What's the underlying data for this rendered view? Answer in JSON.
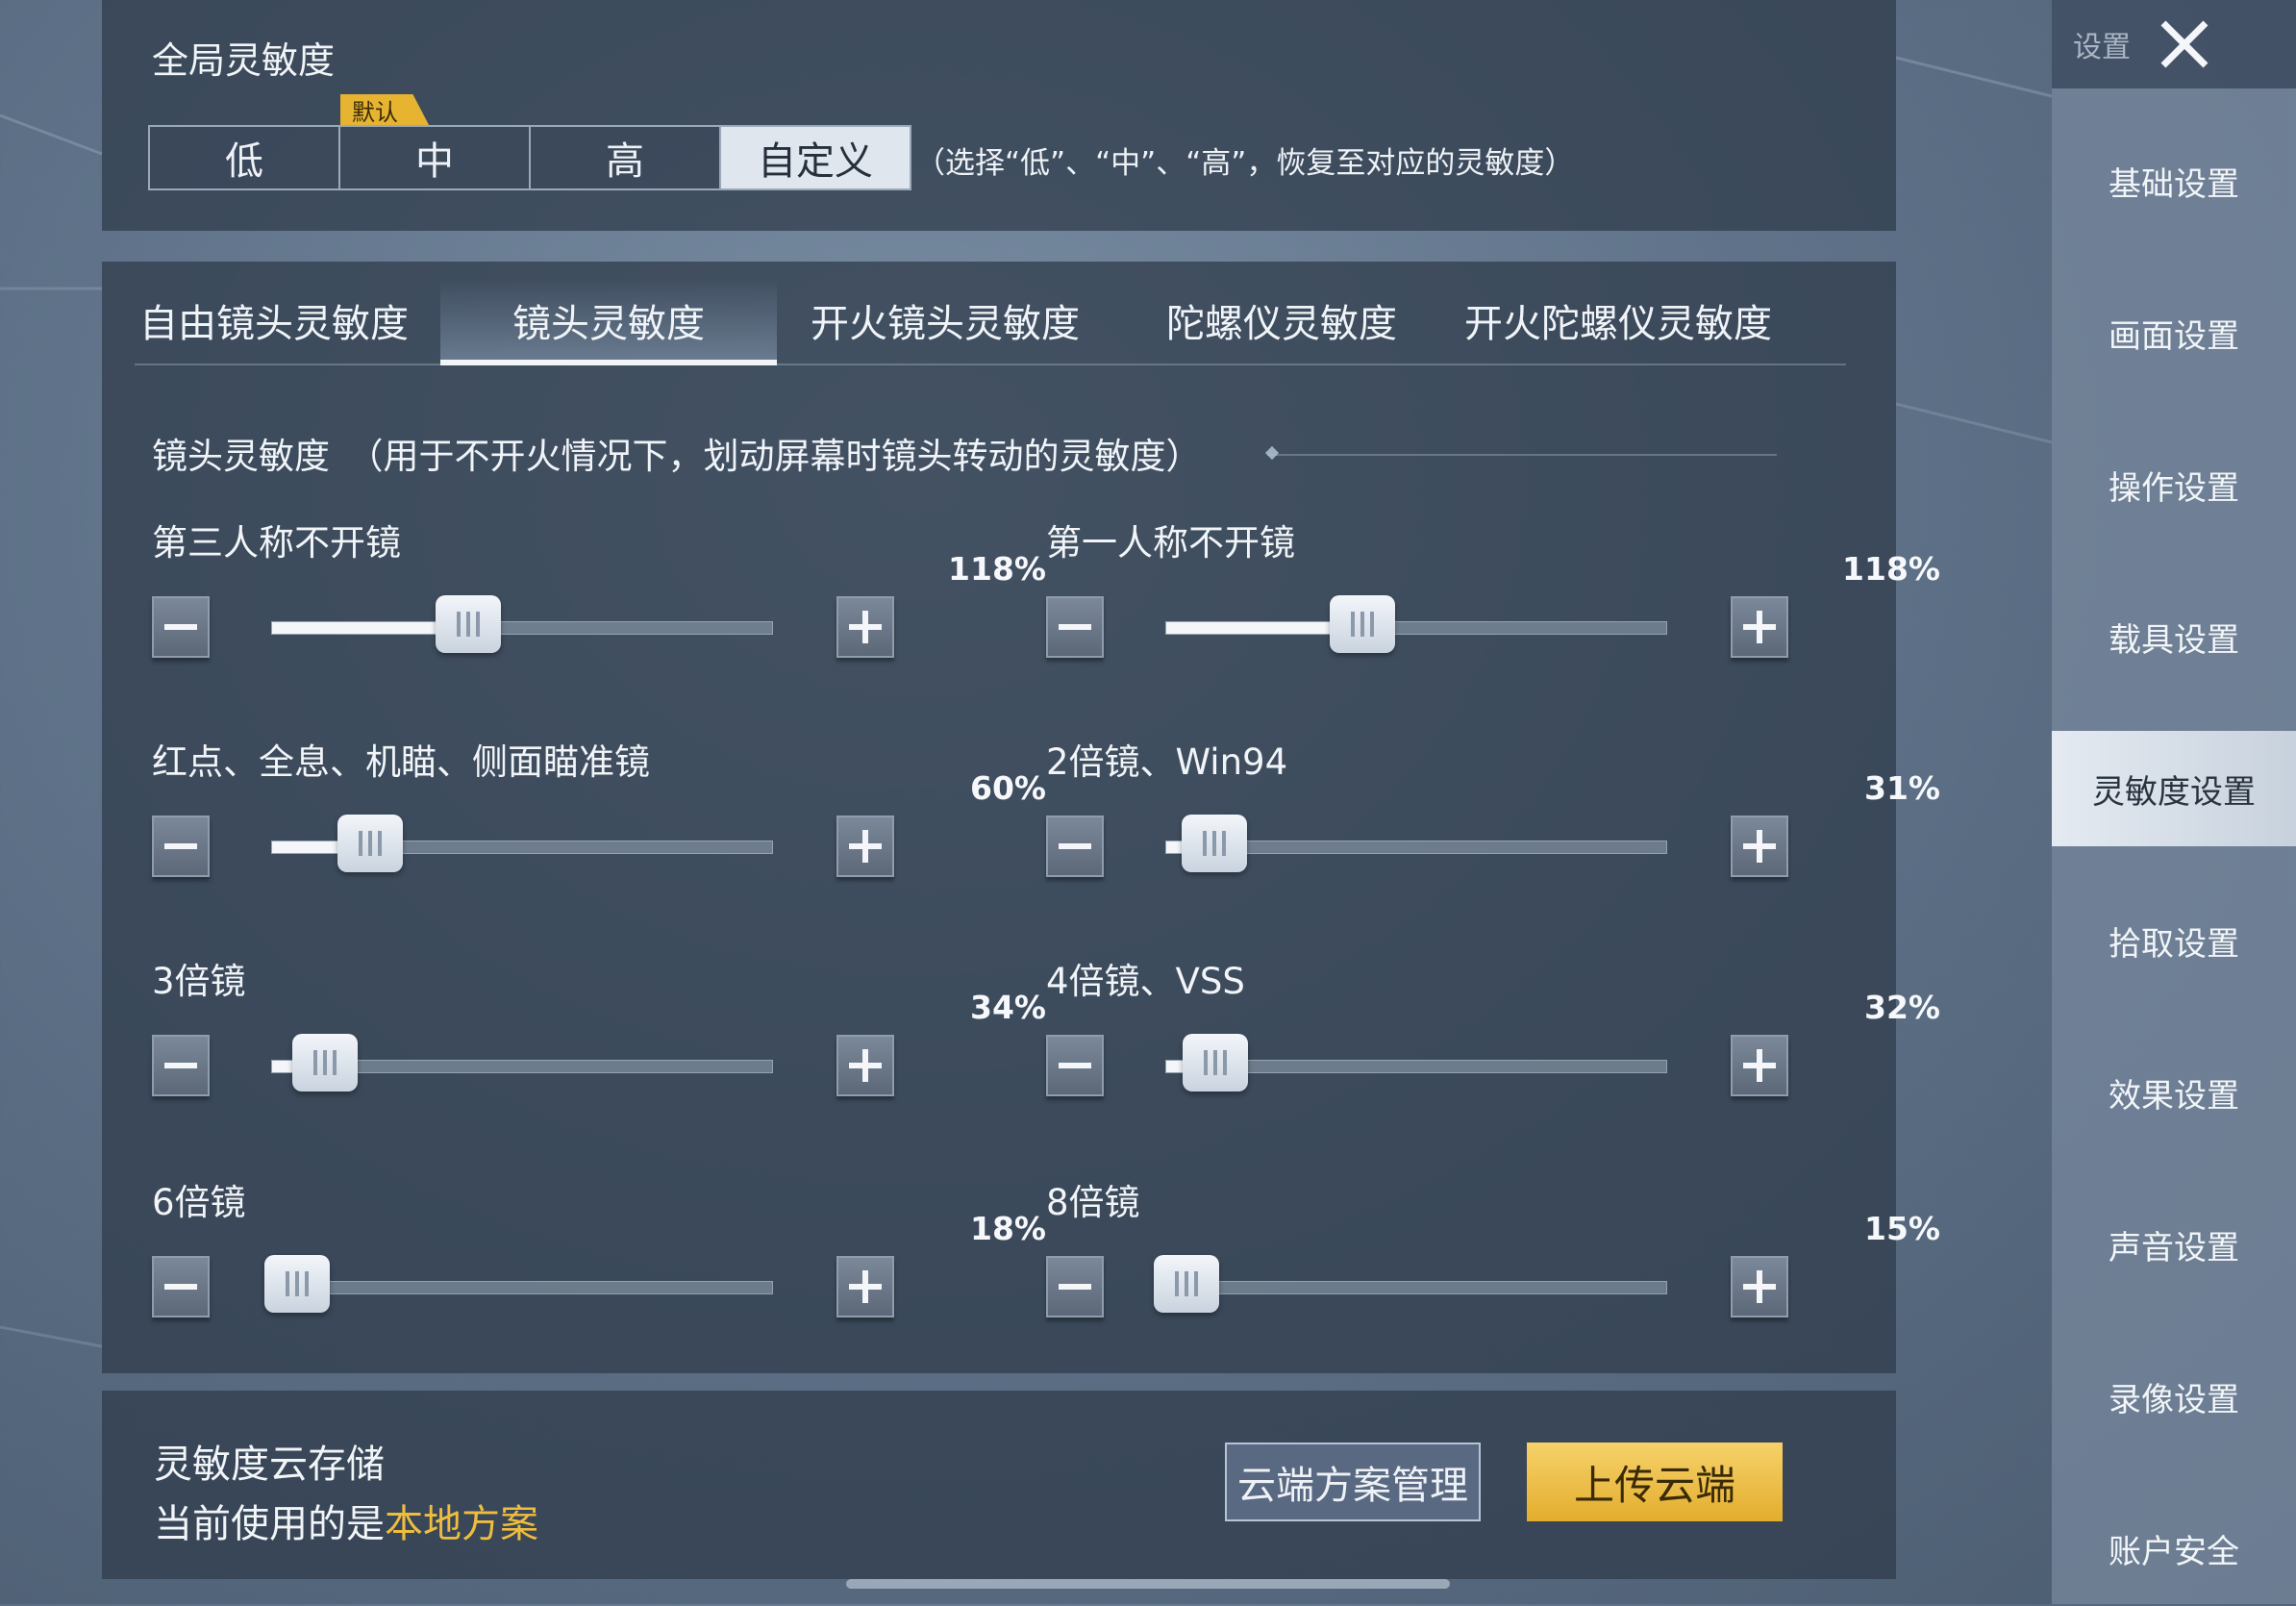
{
  "global": {
    "title": "全局灵敏度",
    "default_tag": "默认",
    "presets": [
      "低",
      "中",
      "高",
      "自定义"
    ],
    "active_preset": 3,
    "note": "（选择“低”、“中”、“高”，恢复至对应的灵敏度）"
  },
  "tabs": [
    {
      "label": "自由镜头灵敏度"
    },
    {
      "label": "镜头灵敏度"
    },
    {
      "label": "开火镜头灵敏度"
    },
    {
      "label": "陀螺仪灵敏度"
    },
    {
      "label": "开火陀螺仪灵敏度"
    }
  ],
  "active_tab": 1,
  "section": {
    "heading": "镜头灵敏度　（用于不开火情况下，划动屏幕时镜头转动的灵敏度）"
  },
  "sliders": [
    {
      "label": "第三人称不开镜",
      "value_text": "118%",
      "fraction": 0.39
    },
    {
      "label": "第一人称不开镜",
      "value_text": "118%",
      "fraction": 0.39
    },
    {
      "label": "红点、全息、机瞄、侧面瞄准镜",
      "value_text": "60%",
      "fraction": 0.195
    },
    {
      "label": "2倍镜、Win94",
      "value_text": "31%",
      "fraction": 0.095
    },
    {
      "label": "3倍镜",
      "value_text": "34%",
      "fraction": 0.105
    },
    {
      "label": "4倍镜、VSS",
      "value_text": "32%",
      "fraction": 0.098
    },
    {
      "label": "6倍镜",
      "value_text": "18%",
      "fraction": 0.05
    },
    {
      "label": "8倍镜",
      "value_text": "15%",
      "fraction": 0.04
    }
  ],
  "cloud": {
    "title": "灵敏度云存储",
    "current_prefix": "当前使用的是",
    "current_plan": "本地方案",
    "manage_label": "云端方案管理",
    "upload_label": "上传云端"
  },
  "sidebar": {
    "header": "设置",
    "items": [
      {
        "label": "基础设置"
      },
      {
        "label": "画面设置"
      },
      {
        "label": "操作设置"
      },
      {
        "label": "载具设置"
      },
      {
        "label": "灵敏度设置"
      },
      {
        "label": "拾取设置"
      },
      {
        "label": "效果设置"
      },
      {
        "label": "声音设置"
      },
      {
        "label": "录像设置"
      },
      {
        "label": "账户安全"
      }
    ],
    "active_index": 4
  },
  "colors": {
    "accent_gold": "#e7b432",
    "highlight_text": "#efbd3e",
    "panel_bg": "#2e3a4a"
  }
}
